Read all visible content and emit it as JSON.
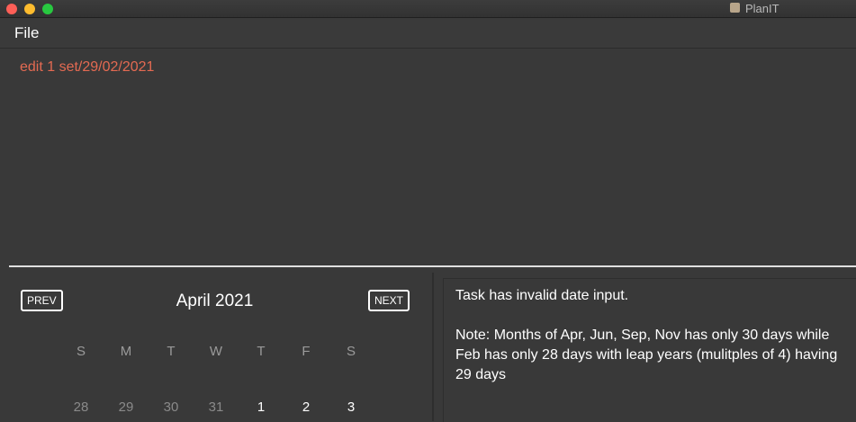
{
  "window": {
    "title": "PlanIT",
    "controls": [
      "close",
      "minimize",
      "maximize"
    ]
  },
  "menu": {
    "file": "File"
  },
  "command": {
    "text": "edit 1 set/29/02/2021",
    "color": "#e46a52"
  },
  "calendar": {
    "prev_label": "PREV",
    "next_label": "NEXT",
    "month_title": "April 2021",
    "weekdays": [
      "S",
      "M",
      "T",
      "W",
      "T",
      "F",
      "S"
    ],
    "first_row": [
      {
        "day": "28",
        "in_month": false
      },
      {
        "day": "29",
        "in_month": false
      },
      {
        "day": "30",
        "in_month": false
      },
      {
        "day": "31",
        "in_month": false
      },
      {
        "day": "1",
        "in_month": true
      },
      {
        "day": "2",
        "in_month": true
      },
      {
        "day": "3",
        "in_month": true
      }
    ]
  },
  "result": {
    "message": "Task has invalid date input.\n\nNote: Months of Apr, Jun, Sep, Nov has only 30 days while Feb has only 28 days with leap years (mulitples of 4) having 29 days"
  },
  "colors": {
    "background": "#393939",
    "text": "#ffffff",
    "accent_error": "#e46a52"
  }
}
